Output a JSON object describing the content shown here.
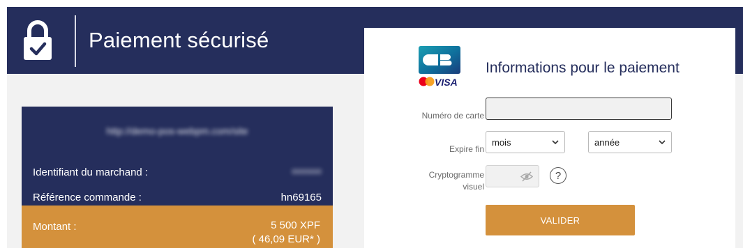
{
  "header": {
    "title": "Paiement sécurisé",
    "icon": "lock-check-icon"
  },
  "merchant": {
    "url": "http://demo-pos-webpm.com/site",
    "merchant_id_label": "Identifiant du marchand :",
    "merchant_id_value": "0000000",
    "order_ref_label": "Référence commande :",
    "order_ref_value": "hn69165",
    "amount_label": "Montant :",
    "amount_xpf": "5 500 XPF",
    "amount_eur": "( 46,09 EUR* )"
  },
  "payment": {
    "title": "Informations pour le paiement",
    "logos": {
      "cb": "cb-logo-icon",
      "mastercard": "mastercard-logo-icon",
      "visa_text": "VISA"
    },
    "card_number_label": "Numéro de carte",
    "card_number_value": "",
    "expiry_label": "Expire fin",
    "month_selected": "mois",
    "year_selected": "année",
    "cvv_label_line1": "Cryptogramme",
    "cvv_label_line2": "visuel",
    "help_text": "?",
    "submit_label": "VALIDER"
  },
  "colors": {
    "navy": "#252e5c",
    "accent": "#d4913c",
    "background": "#f2f2f2"
  }
}
